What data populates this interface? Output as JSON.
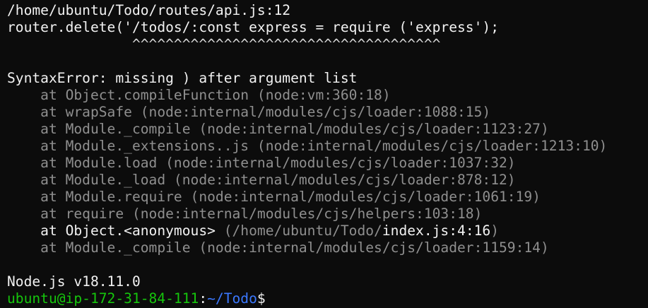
{
  "terminal": {
    "file_location": "/home/ubuntu/Todo/routes/api.js:12",
    "source_line": "router.delete('/todos/:const express = require ('express');",
    "caret_indent": "               ",
    "caret_marks": "^^^^^^^^^^^^^^^^^^^^^^^^^^^^^^^^^^^^^",
    "error_message": "SyntaxError: missing ) after argument list",
    "stack": [
      "    at Object.compileFunction (node:vm:360:18)",
      "    at wrapSafe (node:internal/modules/cjs/loader:1088:15)",
      "    at Module._compile (node:internal/modules/cjs/loader:1123:27)",
      "    at Module._extensions..js (node:internal/modules/cjs/loader:1213:10)",
      "    at Module.load (node:internal/modules/cjs/loader:1037:32)",
      "    at Module._load (node:internal/modules/cjs/loader:878:12)",
      "    at Module.require (node:internal/modules/cjs/loader:1061:19)",
      "    at require (node:internal/modules/cjs/helpers:103:18)"
    ],
    "anon_frame": {
      "prefix": "    at Object.<anonymous> ",
      "path_open": "(/home/ubuntu/Todo/",
      "file": "index.js:4:16",
      "close": ")"
    },
    "last_frame": "    at Module._compile (node:internal/modules/cjs/loader:1159:14)",
    "node_version": "Node.js v18.11.0",
    "prompt": {
      "user_host": "ubuntu@ip-172-31-84-111",
      "separator": ":",
      "path": "~/Todo",
      "symbol": "$"
    }
  },
  "colors": {
    "background": "#0c0c0c",
    "text": "#cccccc",
    "bright_text": "#f2f2f2",
    "dim_text": "#8f8f8f",
    "prompt_user": "#16c60c",
    "prompt_path": "#3b78ff"
  }
}
